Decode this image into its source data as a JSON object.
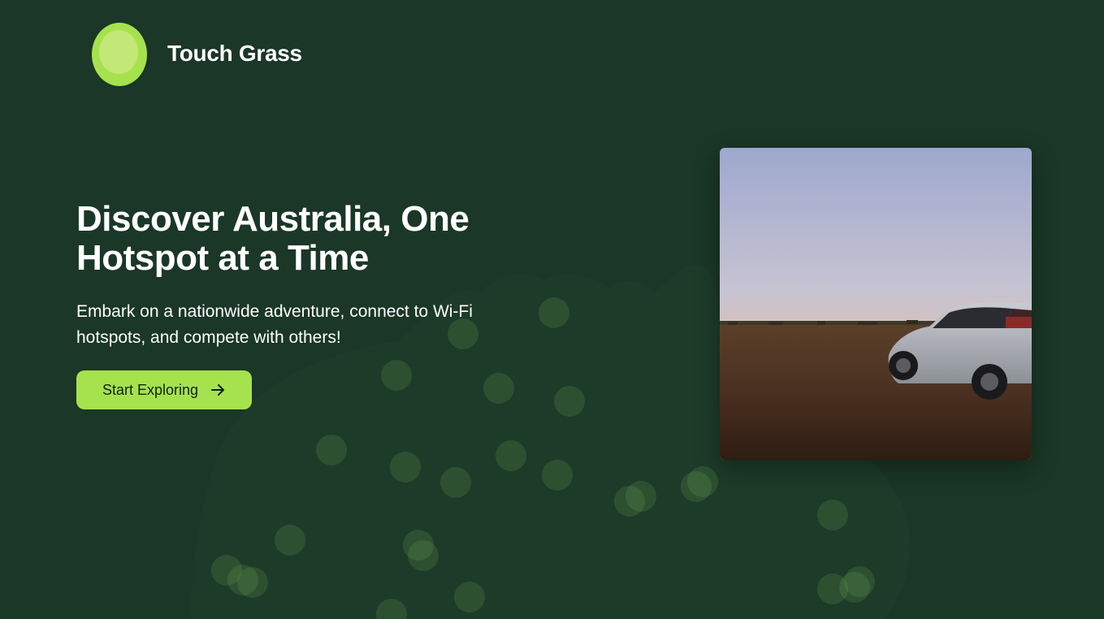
{
  "brand": {
    "name": "Touch Grass",
    "logo_icon": "green-egg-logo-icon",
    "accent_color": "#a6e24e"
  },
  "hero": {
    "title_line1": "Discover Australia, One",
    "title_line2": "Hotspot at a Time",
    "subtitle_line1": "Embark on a nationwide adventure, connect to Wi-Fi",
    "subtitle_line2": "hotspots, and compete with others!",
    "cta_label": "Start Exploring",
    "cta_icon": "arrow-right-icon"
  },
  "photo": {
    "subject": "car-in-desert-at-dusk-image"
  },
  "background": {
    "color": "#1a3727",
    "map": "australia-map-silhouette"
  }
}
